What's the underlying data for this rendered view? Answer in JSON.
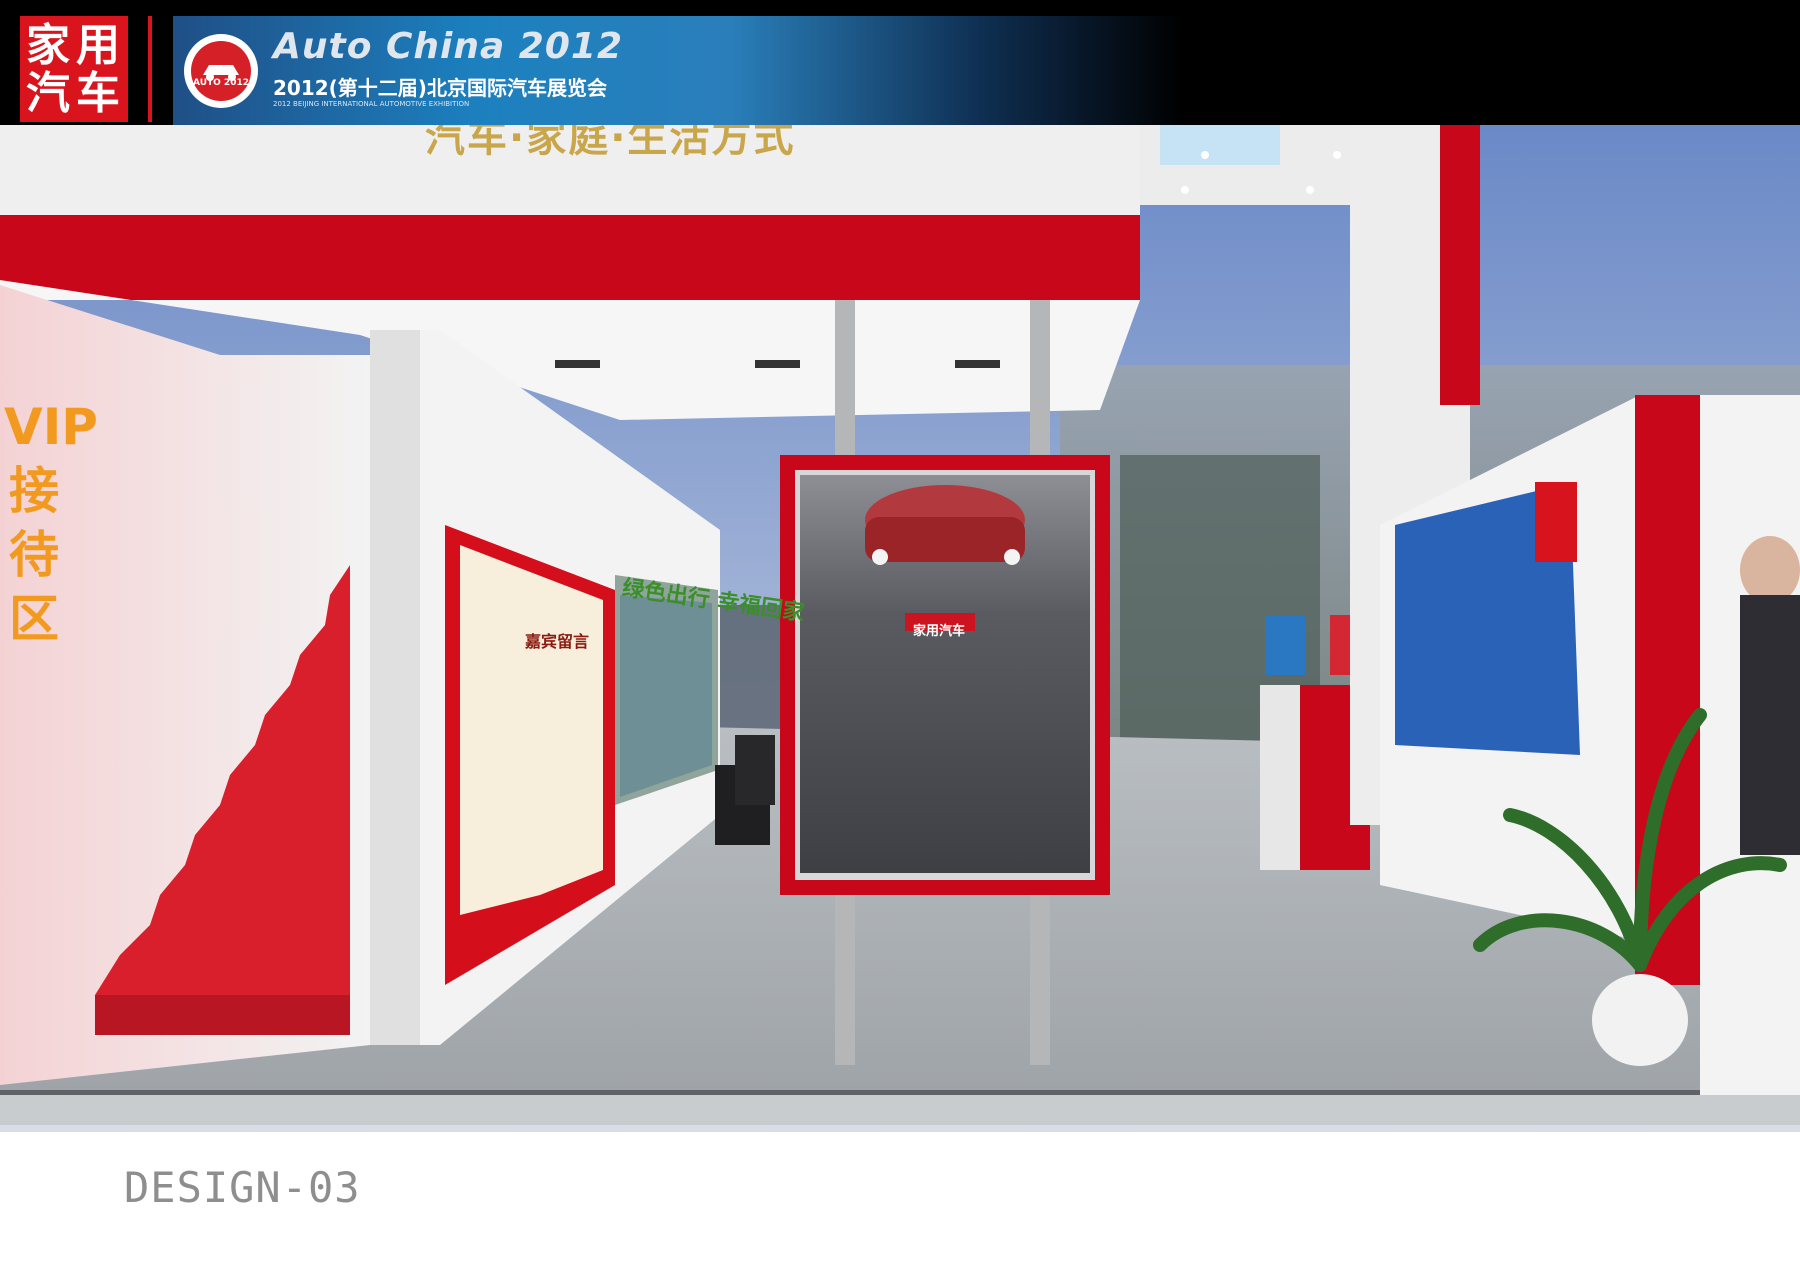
{
  "header": {
    "logo_char_1": "家",
    "logo_char_2": "用",
    "logo_char_3": "汽",
    "logo_char_4": "车",
    "badge_text": "AUTO 2012",
    "banner_title": "Auto China 2012",
    "banner_subtitle": "2012(第十二届)北京国际汽车展览会",
    "banner_english": "2012 BEIJING INTERNATIONAL AUTOMOTIVE EXHIBITION"
  },
  "scene": {
    "top_slogan": "汽车·家庭·生活方式",
    "vip_sign": "VIP接待区",
    "green_slogan": "绿色出行 幸福回家",
    "guest_board_label": "嘉宾留言",
    "car_plate": "家用汽车"
  },
  "footer": {
    "caption": "DESIGN-03"
  },
  "colors": {
    "brand_red": "#d9141c",
    "banner_blue": "#1c80bf",
    "vip_orange": "#f29a1f",
    "floor_gray": "#a7acb0"
  }
}
